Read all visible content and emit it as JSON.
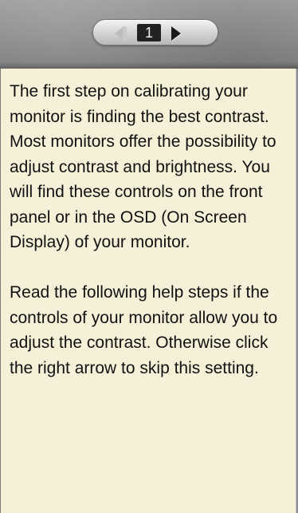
{
  "pager": {
    "page_number": "1",
    "prev_icon": "arrow-left-icon",
    "next_icon": "arrow-right-icon"
  },
  "help": {
    "paragraph_1": "The first step on calibrating your monitor is finding the best contrast. Most monitors offer the possibility to adjust contrast and brightness. You will find these controls on the front panel or in the OSD (On Screen Display) of your monitor.",
    "paragraph_2": "Read the following help steps if the controls of your monitor allow you to adjust the contrast. Otherwise click the right arrow to skip this setting."
  },
  "colors": {
    "panel_background": "#f5f0d8",
    "header_background": "#8f8f8f",
    "text": "#111111"
  }
}
